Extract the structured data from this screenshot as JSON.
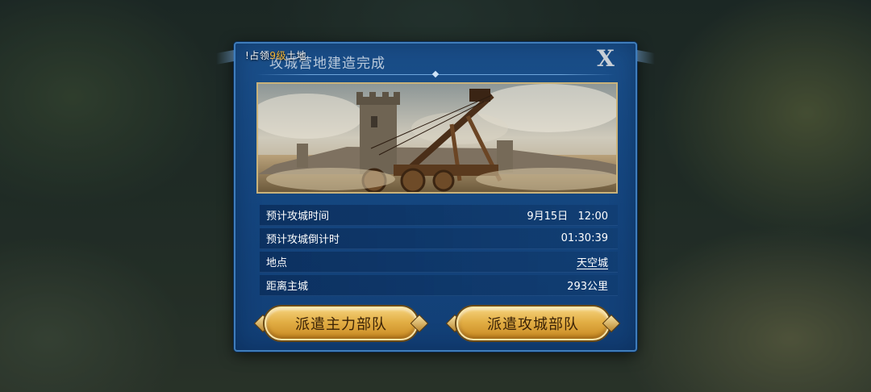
{
  "notice": {
    "prefix": "!占领",
    "highlight": "9级",
    "suffix": "土地"
  },
  "dialog": {
    "title": "攻城营地建造完成",
    "close_label": "X"
  },
  "info_rows": [
    {
      "label": "预计攻城时间",
      "value": "9月15日   12:00"
    },
    {
      "label": "预计攻城倒计时",
      "value": "01:30:39"
    },
    {
      "label": "地点",
      "value": "天空城"
    },
    {
      "label": "距离主城",
      "value": "293公里"
    }
  ],
  "buttons": {
    "dispatch_main": "派遣主力部队",
    "dispatch_siege": "派遣攻城部队"
  },
  "colors": {
    "panel_blue": "#14457e",
    "panel_border": "#3f7dbb",
    "button_gold": "#e2ae45",
    "notice_highlight": "#f3b73a"
  },
  "icons": {
    "close": "close-x-icon",
    "banner": "siege-catapult-castle-illustration"
  }
}
